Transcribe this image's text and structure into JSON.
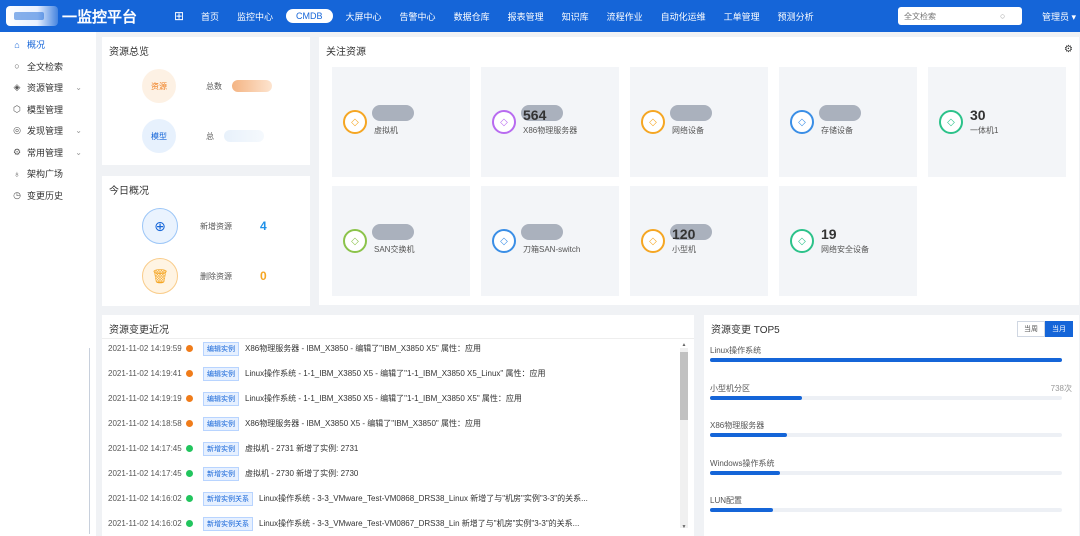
{
  "app": {
    "title": "一监控平台"
  },
  "topnav": {
    "items": [
      "首页",
      "监控中心",
      "CMDB",
      "大屏中心",
      "告警中心",
      "数据仓库",
      "报表管理",
      "知识库",
      "流程作业",
      "自动化运维",
      "工单管理",
      "预测分析"
    ],
    "active": "CMDB",
    "search_placeholder": "全文检索",
    "user": "管理员 ▾"
  },
  "sidebar": {
    "items": [
      {
        "label": "概况",
        "icon": "home-icon"
      },
      {
        "label": "全文检索",
        "icon": "search-icon"
      },
      {
        "label": "资源管理",
        "icon": "layers-icon"
      },
      {
        "label": "模型管理",
        "icon": "cube-icon"
      },
      {
        "label": "发现管理",
        "icon": "compass-icon"
      },
      {
        "label": "常用管理",
        "icon": "gear-icon"
      },
      {
        "label": "架构广场",
        "icon": "org-icon"
      },
      {
        "label": "变更历史",
        "icon": "clock-icon"
      }
    ]
  },
  "overview": {
    "title": "资源总览",
    "resource_circle": "资源",
    "resource_label": "总数",
    "model_circle": "模型",
    "model_label": "总"
  },
  "today": {
    "title": "今日概况",
    "new_label": "新增资源",
    "new_value": "4",
    "deleted_label": "删除资源",
    "deleted_value": "0"
  },
  "focus": {
    "title": "关注资源",
    "cards": [
      {
        "name": "虚拟机",
        "value": "",
        "color": "#f5a623"
      },
      {
        "name": "X86物理服务器",
        "value": "564",
        "color": "#b86bf0"
      },
      {
        "name": "网络设备",
        "value": "",
        "color": "#f5a623"
      },
      {
        "name": "存储设备",
        "value": "",
        "color": "#3a8ee6"
      },
      {
        "name": "一体机1",
        "value": "30",
        "color": "#2cc28a"
      },
      {
        "name": "SAN交换机",
        "value": "",
        "color": "#8bc34a"
      },
      {
        "name": "刀箱SAN-switch",
        "value": "",
        "color": "#3a8ee6"
      },
      {
        "name": "小型机",
        "value": "120",
        "color": "#f5a623"
      },
      {
        "name": "网络安全设备",
        "value": "19",
        "color": "#2cc28a"
      }
    ]
  },
  "changes": {
    "title": "资源变更近况",
    "rows": [
      {
        "time": "2021-11-02 14:19:59",
        "dot": "#f07c1a",
        "tag": "编辑实例",
        "text": "X86物理服务器 - IBM_X3850 - 编辑了\"IBM_X3850 X5\" 属性：应用"
      },
      {
        "time": "2021-11-02 14:19:41",
        "dot": "#f07c1a",
        "tag": "编辑实例",
        "text": "Linux操作系统 - 1-1_IBM_X3850 X5 - 编辑了\"1-1_IBM_X3850 X5_Linux\" 属性：应用"
      },
      {
        "time": "2021-11-02 14:19:19",
        "dot": "#f07c1a",
        "tag": "编辑实例",
        "text": "Linux操作系统 - 1-1_IBM_X3850 X5 - 编辑了\"1-1_IBM_X3850 X5\" 属性：应用"
      },
      {
        "time": "2021-11-02 14:18:58",
        "dot": "#f07c1a",
        "tag": "编辑实例",
        "text": "X86物理服务器 - IBM_X3850 X5 - 编辑了\"IBM_X3850\" 属性：应用"
      },
      {
        "time": "2021-11-02 14:17:45",
        "dot": "#22c55e",
        "tag": "新增实例",
        "text": "虚拟机 - 2731   新增了实例: 2731"
      },
      {
        "time": "2021-11-02 14:17:45",
        "dot": "#22c55e",
        "tag": "新增实例",
        "text": "虚拟机 - 2730   新增了实例: 2730"
      },
      {
        "time": "2021-11-02 14:16:02",
        "dot": "#22c55e",
        "tag": "新增实例关系",
        "text": "Linux操作系统 - 3-3_VMware_Test-VM0868_DRS38_Linux   新增了与\"机房\"实例\"3-3\"的关系..."
      },
      {
        "time": "2021-11-02 14:16:02",
        "dot": "#22c55e",
        "tag": "新增实例关系",
        "text": "Linux操作系统 - 3-3_VMware_Test-VM0867_DRS38_Lin   新增了与\"机房\"实例\"3-3\"的关系..."
      }
    ]
  },
  "top5": {
    "title": "资源变更 TOP5",
    "tab_week": "当周",
    "tab_month": "当月",
    "items": [
      {
        "name": "Linux操作系统",
        "count": "",
        "fraction": 1.0
      },
      {
        "name": "小型机分区",
        "count": "738次",
        "fraction": 0.26
      },
      {
        "name": "X86物理服务器",
        "count": "",
        "fraction": 0.22
      },
      {
        "name": "Windows操作系统",
        "count": "",
        "fraction": 0.2
      },
      {
        "name": "LUN配置",
        "count": "",
        "fraction": 0.18
      }
    ]
  }
}
